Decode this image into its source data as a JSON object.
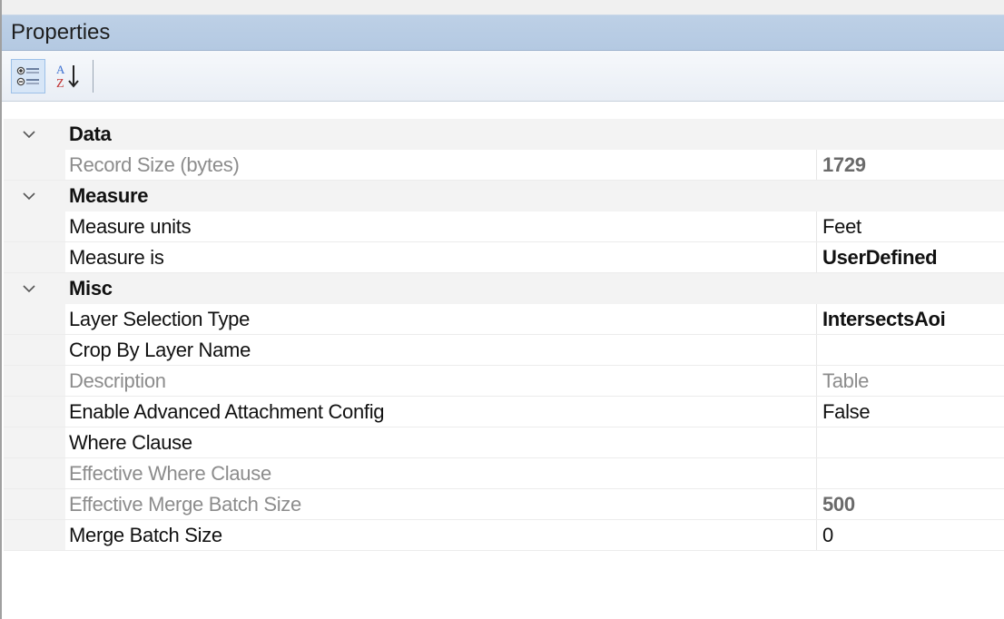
{
  "panel": {
    "title": "Properties"
  },
  "toolbar": {
    "categorized_icon": "categorized-view-icon",
    "alphabetical_icon": "alphabetical-sort-icon"
  },
  "categories": [
    {
      "name": "Data",
      "expanded": true,
      "properties": [
        {
          "name": "Record Size (bytes)",
          "value": "1729",
          "readonly": true,
          "value_bold": true
        }
      ]
    },
    {
      "name": "Measure",
      "expanded": true,
      "properties": [
        {
          "name": "Measure units",
          "value": "Feet",
          "readonly": false,
          "value_bold": false
        },
        {
          "name": "Measure is",
          "value": "UserDefined",
          "readonly": false,
          "value_bold": true
        }
      ]
    },
    {
      "name": "Misc",
      "expanded": true,
      "properties": [
        {
          "name": "Layer Selection Type",
          "value": "IntersectsAoi",
          "readonly": false,
          "value_bold": true
        },
        {
          "name": "Crop By Layer Name",
          "value": "",
          "readonly": false,
          "value_bold": false
        },
        {
          "name": "Description",
          "value": "Table",
          "readonly": true,
          "value_bold": false
        },
        {
          "name": "Enable Advanced Attachment Config",
          "value": "False",
          "readonly": false,
          "value_bold": false
        },
        {
          "name": "Where Clause",
          "value": "",
          "readonly": false,
          "value_bold": false
        },
        {
          "name": "Effective Where Clause",
          "value": "",
          "readonly": true,
          "value_bold": false
        },
        {
          "name": "Effective Merge Batch Size",
          "value": "500",
          "readonly": true,
          "value_bold": true
        },
        {
          "name": "Merge Batch Size",
          "value": "0",
          "readonly": false,
          "value_bold": false
        }
      ]
    }
  ],
  "colors": {
    "title_bar": "#bdd0e6",
    "readonly_text": "#8c8c8c",
    "category_background": "#f3f3f3"
  }
}
